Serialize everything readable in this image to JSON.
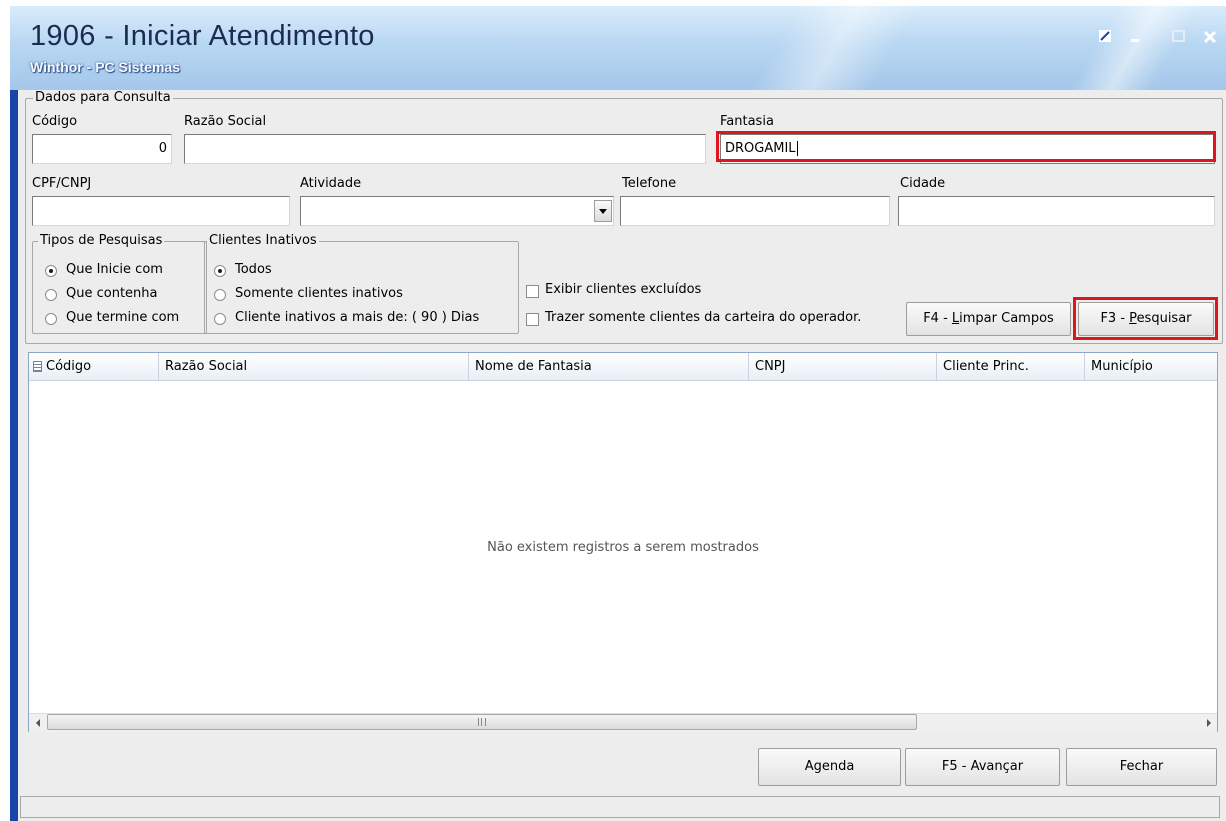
{
  "window": {
    "title": "1906 - Iniciar Atendimento",
    "subtitle": "Winthor - PC Sistemas",
    "restore_icon": "restore-icon",
    "minimize_icon": "minimize-icon",
    "maximize_icon": "maximize-icon",
    "close_icon": "close-icon"
  },
  "consulta": {
    "group_title": "Dados para Consulta",
    "codigo_label": "Código",
    "codigo_value": "0",
    "razao_label": "Razão Social",
    "razao_value": "",
    "fantasia_label": "Fantasia",
    "fantasia_value": "DROGAMIL",
    "cpf_label": "CPF/CNPJ",
    "cpf_value": "",
    "atividade_label": "Atividade",
    "atividade_value": "",
    "telefone_label": "Telefone",
    "telefone_value": "",
    "cidade_label": "Cidade",
    "cidade_value": ""
  },
  "tipos": {
    "title": "Tipos de Pesquisas",
    "options": [
      "Que Inicie com",
      "Que contenha",
      "Que termine com"
    ],
    "selected": 0
  },
  "inativos": {
    "title": "Clientes Inativos",
    "options": [
      "Todos",
      "Somente clientes inativos",
      "Cliente inativos a mais de: ( 90 ) Dias"
    ],
    "selected": 0
  },
  "checks": {
    "excluidos": "Exibir clientes excluídos",
    "carteira": "Trazer somente clientes da carteira do operador."
  },
  "buttons": {
    "limpar_prefix": "F4 - ",
    "limpar_underlined": "L",
    "limpar_rest": "impar Campos",
    "pesquisar_prefix": "F3 - ",
    "pesquisar_underlined": "P",
    "pesquisar_rest": "esquisar",
    "agenda": "Agenda",
    "avancar": "F5 - Avançar",
    "fechar": "Fechar"
  },
  "grid": {
    "columns": [
      "Código",
      "Razão Social",
      "Nome de Fantasia",
      "CNPJ",
      "Cliente Princ.",
      "Município"
    ],
    "empty_message": "Não existem registros a serem mostrados"
  },
  "colors": {
    "highlight": "#e0141d",
    "title_bg": "#b8d7f2",
    "frame": "#1a45a8"
  }
}
